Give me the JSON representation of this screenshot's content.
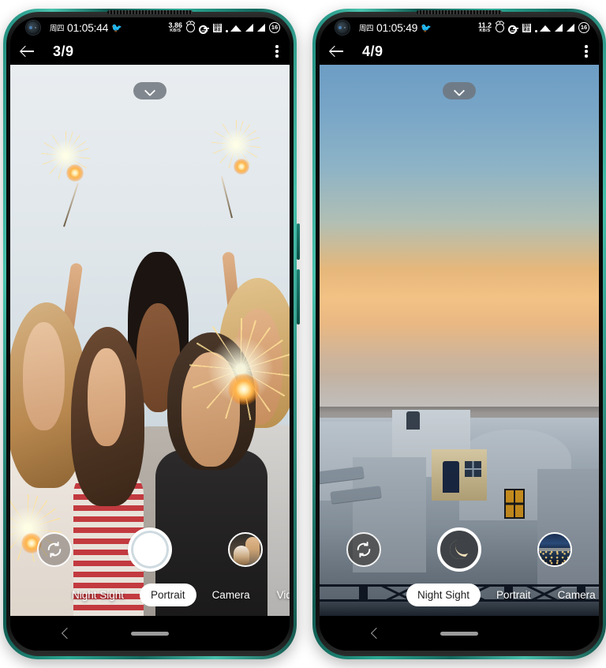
{
  "phones": [
    {
      "id": "phone-left",
      "status_bar": {
        "weekday": "周四",
        "time": "01:05:44",
        "bird_icon": "🐦",
        "network_speed_value": "3.86",
        "network_speed_unit": "KB/S",
        "icons": [
          "alarm-icon",
          "key-icon",
          "qr-icon",
          "wifi-icon",
          "signal-icon",
          "signal-icon"
        ],
        "battery_level": "16"
      },
      "title_bar": {
        "back_icon": "arrow-left-icon",
        "title": "3/9",
        "menu_icon": "kebab-menu-icon"
      },
      "preview": {
        "expand_icon": "chevron-down-icon",
        "scene": "friends-with-sparklers"
      },
      "controls": {
        "flip_icon": "camera-flip-icon",
        "shutter_label": "shutter-button",
        "thumbnail_label": "gallery-thumbnail"
      },
      "modes": [
        {
          "label": "Night Sight",
          "active": false
        },
        {
          "label": "Portrait",
          "active": true
        },
        {
          "label": "Camera",
          "active": false
        },
        {
          "label": "Video",
          "active": false
        }
      ],
      "nav_bar": {
        "back_icon": "chevron-left-icon",
        "home_indicator": "home-pill"
      }
    },
    {
      "id": "phone-right",
      "status_bar": {
        "weekday": "周四",
        "time": "01:05:49",
        "bird_icon": "🐦",
        "network_speed_value": "11.2",
        "network_speed_unit": "KB/S",
        "icons": [
          "alarm-icon",
          "key-icon",
          "qr-icon",
          "wifi-icon",
          "signal-icon",
          "signal-icon"
        ],
        "battery_level": "16"
      },
      "title_bar": {
        "back_icon": "arrow-left-icon",
        "title": "4/9",
        "menu_icon": "kebab-menu-icon"
      },
      "preview": {
        "expand_icon": "chevron-down-icon",
        "scene": "santorini-sunset"
      },
      "controls": {
        "flip_icon": "camera-flip-icon",
        "shutter_label": "shutter-button-night",
        "shutter_icon": "moon-icon",
        "thumbnail_label": "gallery-thumbnail"
      },
      "modes": [
        {
          "label": "Night Sight",
          "active": true
        },
        {
          "label": "Portrait",
          "active": false
        },
        {
          "label": "Camera",
          "active": false
        }
      ],
      "nav_bar": {
        "back_icon": "chevron-left-icon",
        "home_indicator": "home-pill"
      }
    }
  ],
  "colors": {
    "frame_teal": "#2aa893",
    "accent_white": "#ffffff",
    "status_bg": "#000000",
    "mode_active_bg": "#ffffff"
  }
}
